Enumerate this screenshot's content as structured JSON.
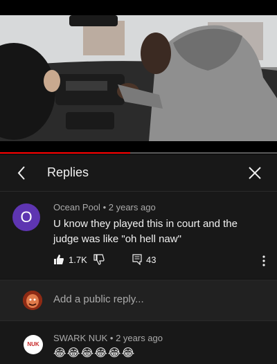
{
  "video": {
    "progress_fraction": 0.47,
    "progress_color": "#ff0000"
  },
  "header": {
    "title": "Replies",
    "back_icon": "chevron-left-icon",
    "close_icon": "close-icon"
  },
  "comment": {
    "avatar_letter": "O",
    "avatar_color": "#5e35b1",
    "author": "Ocean Pool",
    "separator": "•",
    "time": "2 years ago",
    "text": "U know they played this in court and the judge was like \"oh hell naw\"",
    "likes": "1.7K",
    "replies_count": "43"
  },
  "reply_bar": {
    "placeholder": "Add a public reply..."
  },
  "reply": {
    "avatar_text": "NUK",
    "author": "SWARK NUK",
    "separator": "•",
    "time": "2 years ago",
    "text": "😂😂😂😂😂😂"
  }
}
